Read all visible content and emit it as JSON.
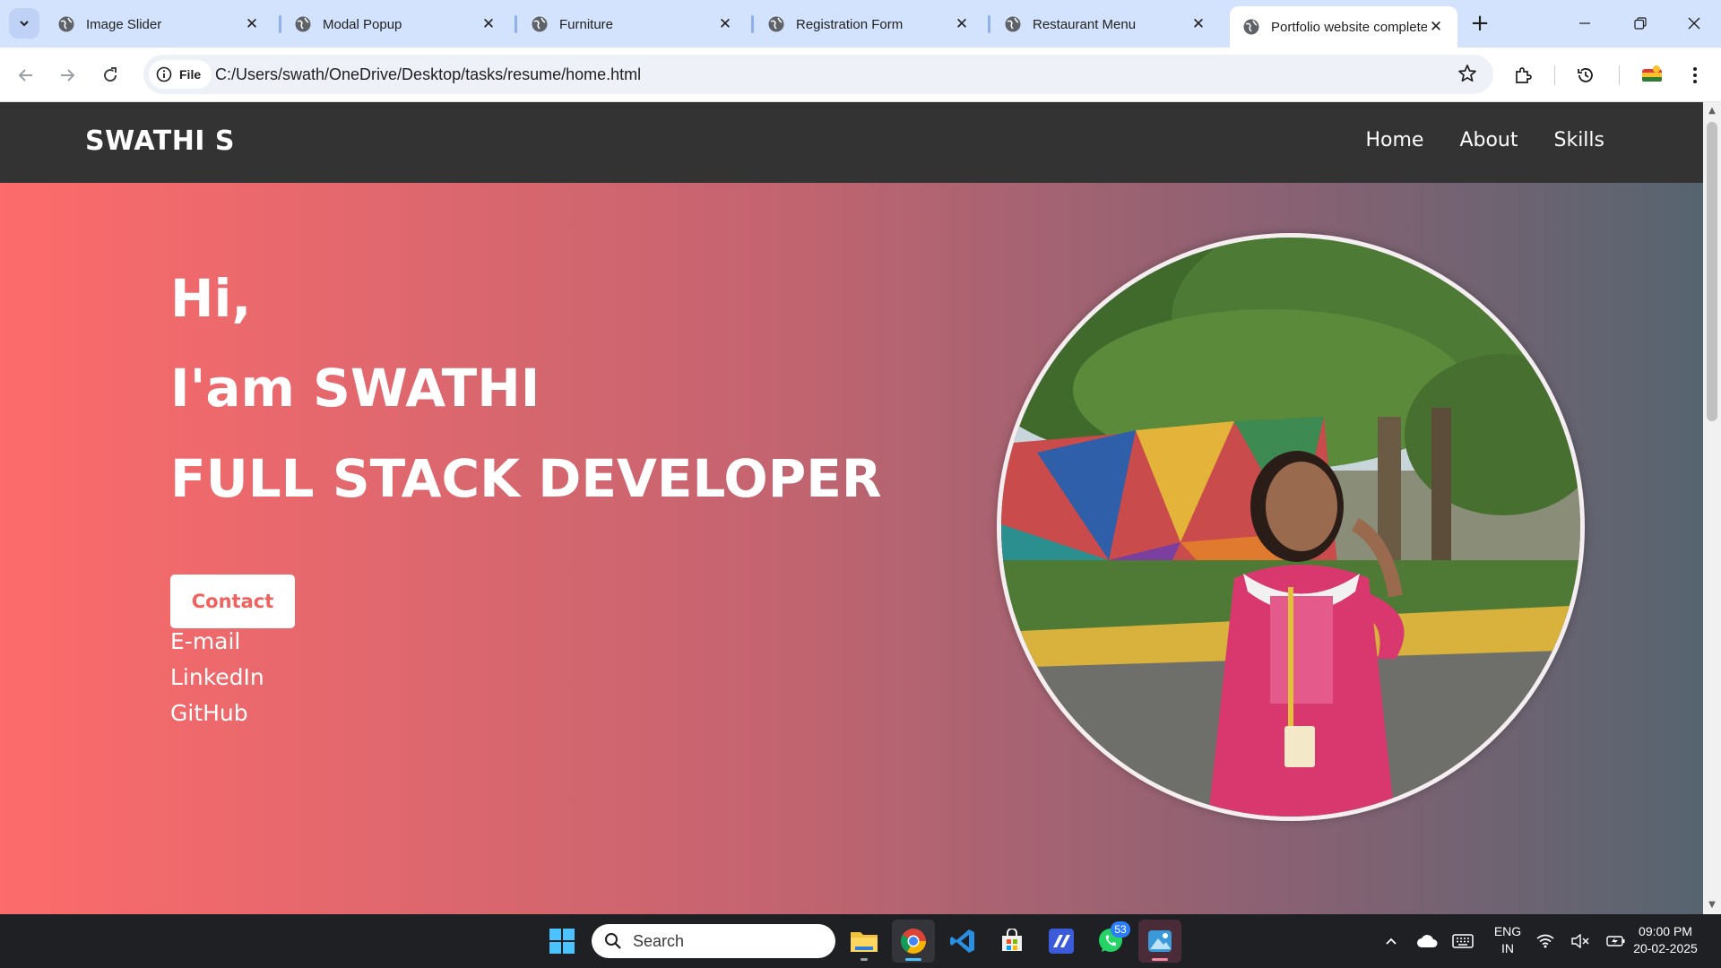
{
  "browser": {
    "tabs": [
      {
        "title": "Image Slider",
        "active": false
      },
      {
        "title": "Modal Popup",
        "active": false
      },
      {
        "title": "Furniture",
        "active": false
      },
      {
        "title": "Registration Form",
        "active": false
      },
      {
        "title": "Restaurant Menu",
        "active": false
      },
      {
        "title": "Portfolio website complete",
        "active": true
      }
    ],
    "address_chip": "File",
    "url": "C:/Users/swath/OneDrive/Desktop/tasks/resume/home.html"
  },
  "site": {
    "brand": "SWATHI S",
    "nav": [
      "Home",
      "About",
      "Skills"
    ],
    "hero": {
      "greeting": "Hi,",
      "name_line": "I'am SWATHI",
      "role": "FULL STACK DEVELOPER",
      "contact_label": "Contact",
      "links": [
        "E-mail",
        "LinkedIn",
        "GitHub"
      ]
    }
  },
  "taskbar": {
    "search_placeholder": "Search",
    "whatsapp_badge": "53",
    "language": "ENG",
    "region": "IN",
    "time": "09:00 PM",
    "date": "20-02-2025"
  },
  "colors": {
    "hero_gradient_start": "#fd6b6b",
    "hero_gradient_end": "#566470",
    "nav_bg": "#333333",
    "contact_text": "#f0625f"
  }
}
